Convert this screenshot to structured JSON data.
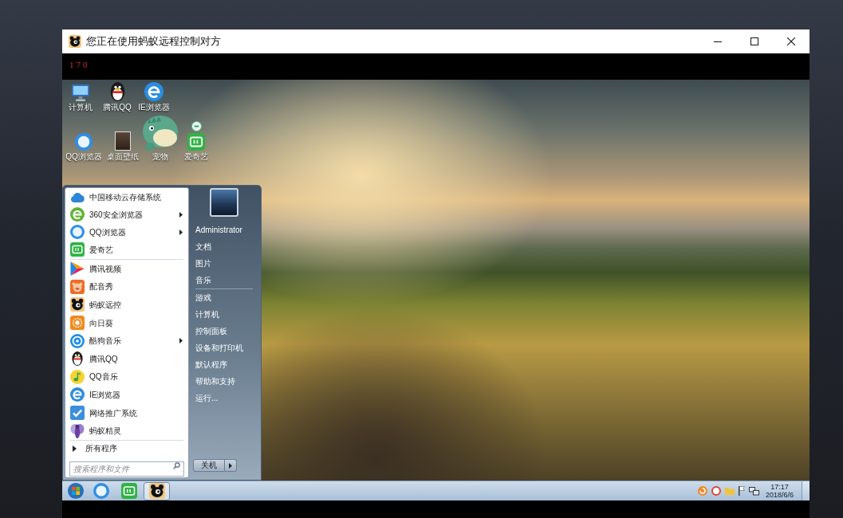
{
  "window": {
    "title": "您正在使用蚂蚁远程控制对方",
    "indicator": "170"
  },
  "desktop": {
    "icon_rows": [
      [
        {
          "label": "计算机"
        },
        {
          "label": "腾讯QQ"
        },
        {
          "label": "IE浏览器"
        }
      ],
      [
        {
          "label": "QQ浏览器"
        },
        {
          "label": "桌面壁纸"
        },
        {
          "label": "宠物"
        },
        {
          "label": "爱奇艺"
        }
      ]
    ]
  },
  "start_menu": {
    "pinned": [
      {
        "label": "中国移动云存储系统",
        "submenu": false
      },
      {
        "label": "360安全浏览器",
        "submenu": true
      },
      {
        "label": "QQ浏览器",
        "submenu": true
      },
      {
        "label": "爱奇艺",
        "submenu": false
      }
    ],
    "recent": [
      {
        "label": "腾讯视频",
        "submenu": false
      },
      {
        "label": "配音秀",
        "submenu": false
      },
      {
        "label": "蚂蚁远控",
        "submenu": false
      },
      {
        "label": "向日葵",
        "submenu": false
      },
      {
        "label": "酷狗音乐",
        "submenu": true
      },
      {
        "label": "腾讯QQ",
        "submenu": false
      },
      {
        "label": "QQ音乐",
        "submenu": false
      },
      {
        "label": "IE浏览器",
        "submenu": false
      },
      {
        "label": "网络推广系统",
        "submenu": false
      },
      {
        "label": "蚂蚁精灵",
        "submenu": false
      }
    ],
    "all_programs": "所有程序",
    "search": {
      "placeholder": "搜索程序和文件"
    },
    "user": "Administrator",
    "library_links": [
      "文档",
      "图片",
      "音乐"
    ],
    "system_links": [
      "游戏",
      "计算机",
      "控制面板",
      "设备和打印机",
      "默认程序",
      "帮助和支持",
      "运行..."
    ],
    "shutdown": "关机"
  },
  "taskbar": {
    "apps": [
      {
        "active": false
      },
      {
        "active": false
      },
      {
        "active": true
      }
    ],
    "clock": {
      "time": "17:17",
      "date": "2018/6/6"
    }
  }
}
